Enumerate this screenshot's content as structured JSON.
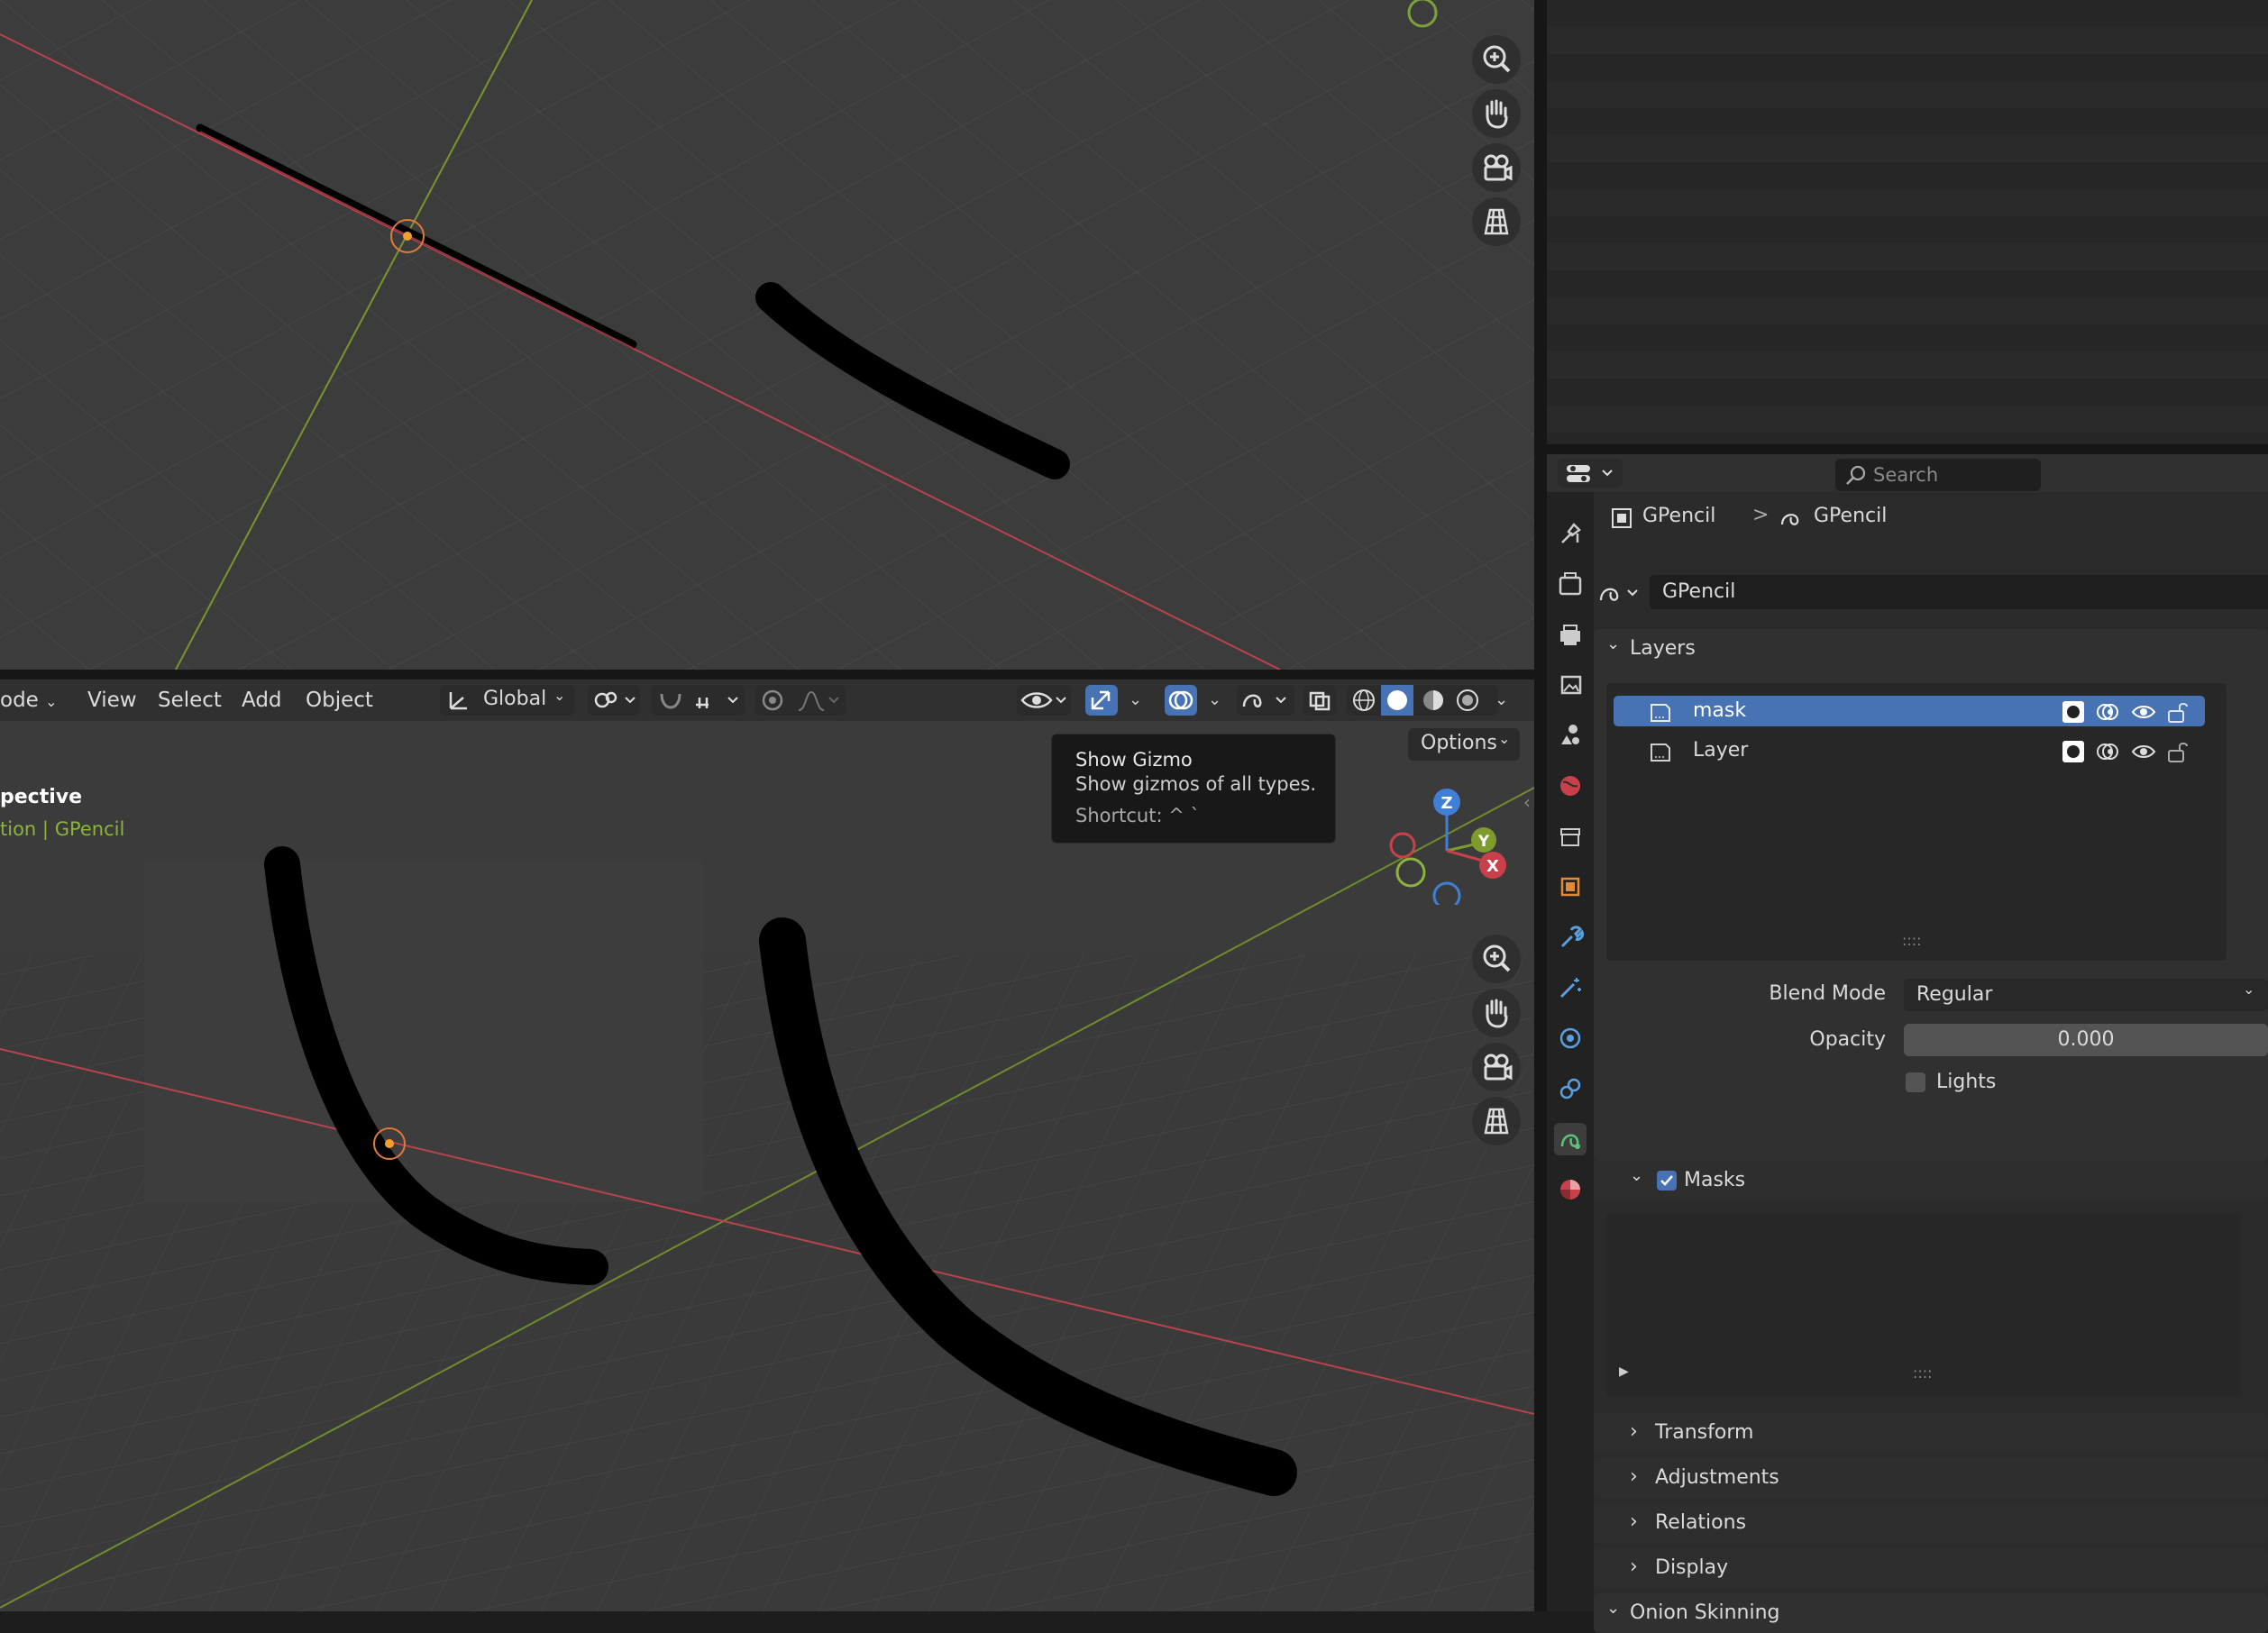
{
  "viewport_bottom": {
    "header_menus": [
      "ode",
      "View",
      "Select",
      "Add",
      "Object"
    ],
    "transform_orientation": "Global",
    "options_label": "Options",
    "overlay_title": "pective",
    "overlay_collection": "tion",
    "overlay_separator": "|",
    "overlay_object": "GPencil"
  },
  "tooltip": {
    "title": "Show Gizmo",
    "description": "Show gizmos of all types.",
    "shortcut": "Shortcut: ^ `"
  },
  "axis_gizmo": {
    "z": "Z",
    "y": "Y",
    "x": "X"
  },
  "properties": {
    "search_placeholder": "Search",
    "breadcrumb_object": "GPencil",
    "breadcrumb_separator": ">",
    "breadcrumb_data": "GPencil",
    "datablock_name": "GPencil",
    "layers_panel_label": "Layers",
    "layers": [
      {
        "name": "mask",
        "selected": true
      },
      {
        "name": "Layer",
        "selected": false
      }
    ],
    "list_grip": "::::",
    "blend_mode_label": "Blend Mode",
    "blend_mode_value": "Regular",
    "opacity_label": "Opacity",
    "opacity_value": "0.000",
    "lights_label": "Lights",
    "masks_label": "Masks",
    "masks_grip": "::::",
    "subpanels": [
      "Transform",
      "Adjustments",
      "Relations",
      "Display"
    ],
    "onion_label": "Onion Skinning"
  },
  "colors": {
    "accent": "#4772b3",
    "x_axis": "#c9404b",
    "y_axis": "#7d9c2d",
    "z_axis": "#3f7fd6",
    "overlay_green": "#8ab43a"
  }
}
